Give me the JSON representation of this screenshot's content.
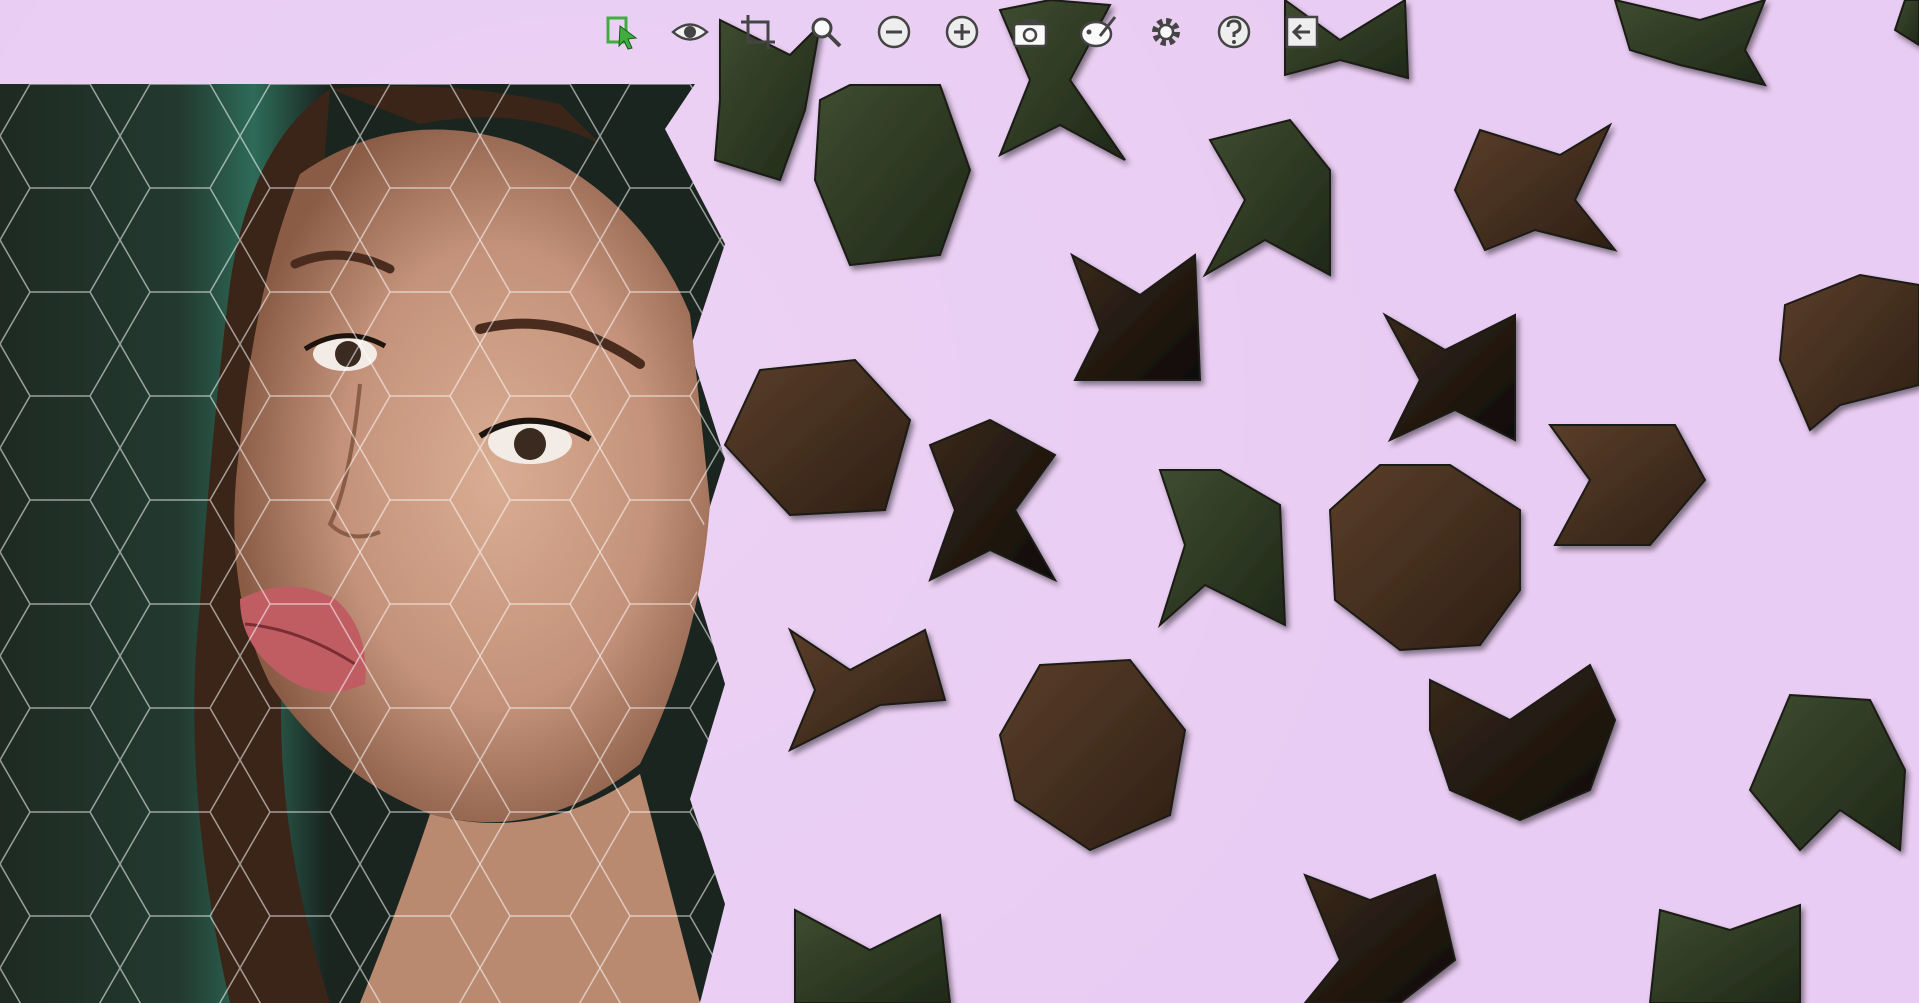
{
  "toolbar": {
    "tools": [
      {
        "name": "select-pieces-tool",
        "icon": "select-arrow-icon"
      },
      {
        "name": "preview-tool",
        "icon": "eye-icon"
      },
      {
        "name": "crop-tool",
        "icon": "crop-icon"
      },
      {
        "name": "magnify-tool",
        "icon": "magnifier-icon"
      },
      {
        "name": "zoom-out-tool",
        "icon": "zoom-out-icon"
      },
      {
        "name": "zoom-in-tool",
        "icon": "zoom-in-icon"
      },
      {
        "name": "screenshot-tool",
        "icon": "camera-icon"
      },
      {
        "name": "background-tool",
        "icon": "palette-icon"
      },
      {
        "name": "settings-tool",
        "icon": "gear-icon"
      },
      {
        "name": "help-tool",
        "icon": "help-icon"
      },
      {
        "name": "exit-tool",
        "icon": "exit-icon"
      }
    ]
  },
  "colors": {
    "board_background": "#e9ccf3",
    "piece_green": "#2f3a24",
    "piece_brown": "#4a3323",
    "piece_dark": "#241a12",
    "accent_select": "#3fae3f"
  },
  "puzzle": {
    "assembled_image": "portrait-of-woman",
    "piece_shapes": [
      "hexagon",
      "octagon",
      "x-star",
      "arrow-chevron"
    ]
  }
}
